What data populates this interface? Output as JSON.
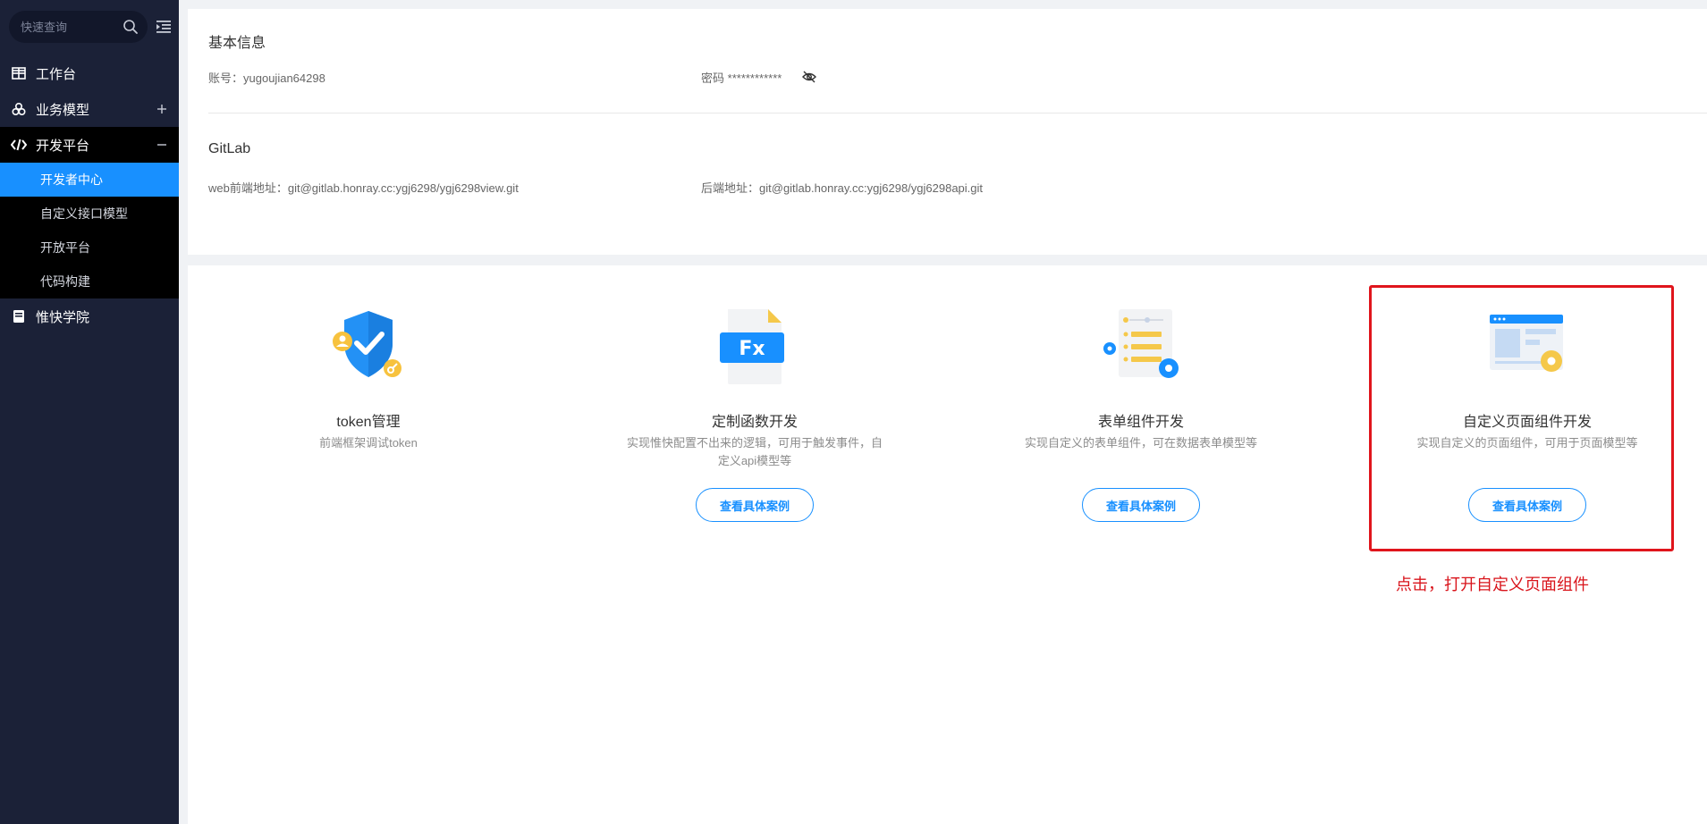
{
  "sidebar": {
    "search": {
      "placeholder": "快速查询"
    },
    "items": [
      {
        "label": "工作台",
        "icon": "grid-icon"
      },
      {
        "label": "业务模型",
        "icon": "cubes-icon",
        "right": "+"
      },
      {
        "label": "开发平台",
        "icon": "code-icon",
        "right": "−"
      },
      {
        "label": "惟快学院",
        "icon": "book-icon"
      }
    ],
    "sub_items": [
      "开发者中心",
      "自定义接口模型",
      "开放平台",
      "代码构建"
    ]
  },
  "basic": {
    "title": "基本信息",
    "account_label": "账号：",
    "account_value": "yugoujian64298",
    "password_label": "密码",
    "password_value": "************"
  },
  "gitlab": {
    "title": "GitLab",
    "web_label": "web前端地址：",
    "web_value": "git@gitlab.honray.cc:ygj6298/ygj6298view.git",
    "api_label": "后端地址：",
    "api_value": "git@gitlab.honray.cc:ygj6298/ygj6298api.git"
  },
  "cards": [
    {
      "title": "token管理",
      "desc": "前端框架调试token",
      "button": ""
    },
    {
      "title": "定制函数开发",
      "desc": "实现惟快配置不出来的逻辑，可用于触发事件，自定义api模型等",
      "button": "查看具体案例"
    },
    {
      "title": "表单组件开发",
      "desc": "实现自定义的表单组件，可在数据表单模型等",
      "button": "查看具体案例"
    },
    {
      "title": "自定义页面组件开发",
      "desc": "实现自定义的页面组件，可用于页面模型等",
      "button": "查看具体案例"
    }
  ],
  "annotation": "点击，打开自定义页面组件",
  "colors": {
    "accent": "#1890ff",
    "sidebar": "#1b2137",
    "highlight": "#e0151c"
  }
}
